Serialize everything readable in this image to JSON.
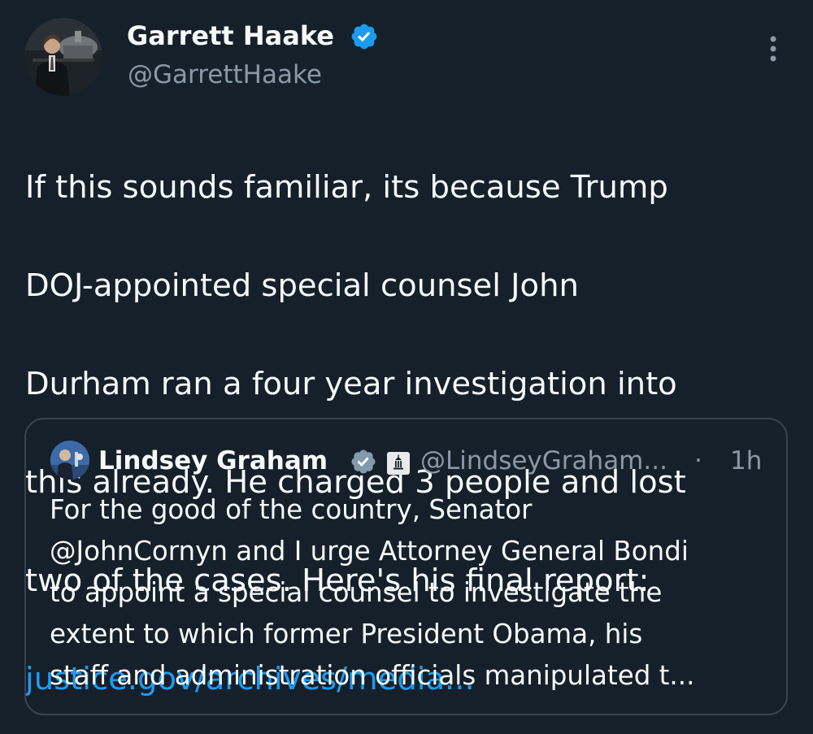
{
  "tweet": {
    "author": {
      "name": "Garrett Haake",
      "handle": "@GarrettHaake",
      "avatar_icon": "profile-photo",
      "verified_icon": "verified-badge-icon"
    },
    "body_lines": [
      "If this sounds familiar, its because Trump",
      "DOJ-appointed special counsel John",
      "Durham ran a four year investigation into",
      "this already. He charged 3 people and lost",
      "two of the cases. Here's his final report:"
    ],
    "link_text": "justice.gov/archives/media...",
    "more_icon": "more-options-icon"
  },
  "quote": {
    "author": {
      "name": "Lindsey Graham",
      "handle": "@LindseyGraham...",
      "separator": "·",
      "time": "1h",
      "verified_icon": "verified-badge-gray-icon",
      "affiliation_icon": "government-building-icon"
    },
    "body_lines": [
      "For the good of the country, Senator",
      "@JohnCornyn and I urge Attorney General Bondi",
      "to appoint a special counsel to investigate the",
      "extent to which former President Obama, his",
      "staff and administration officials manipulated t..."
    ]
  },
  "colors": {
    "background": "#15202b",
    "text": "#f7f9f9",
    "secondary": "#8b98a5",
    "link": "#1d9bf0",
    "verified_blue": "#1d9bf0",
    "border": "#38444d"
  }
}
